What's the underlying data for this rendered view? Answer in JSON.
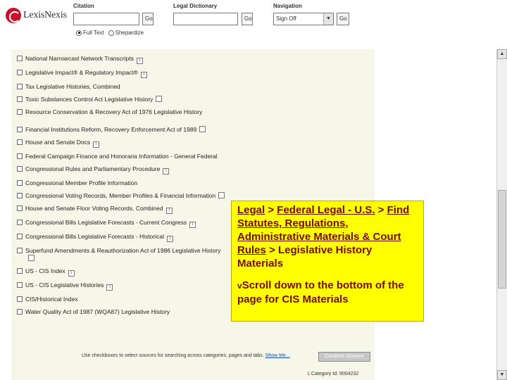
{
  "header": {
    "logo_text": "LexisNexis",
    "citation_label": "Citation",
    "citation_go": "Go",
    "dictionary_label": "Legal Dictionary",
    "dictionary_go": "Go",
    "navigation_label": "Navigation",
    "navigation_selected": "Sign Off",
    "navigation_go": "Go",
    "radio_full_text": "Full Text",
    "radio_shepardize": "Shepardize"
  },
  "list": {
    "items": [
      "National Narrowcast Network Transcripts",
      "Legislative Impact® & Regulatory Impact®",
      "Tax Legislative Histories, Combined",
      "Toxic Substances Control Act Legislative History",
      "Resource Conservation & Recovery Act of 1976 Legislative History",
      "Financial Institutions Reform, Recovery Enforcement Act of 1989",
      "House and Senate Docs",
      "Federal Campaign Finance and Honoraria Information - General Federal",
      "Congressional Rules and Parliamentary Procedure",
      "Congressional Member Profile Information",
      "Congressional Voting Records, Member Profiles & Financial Information",
      "House and Senate Floor Voting Records, Combined",
      "Congressional Bills Legislative Forecasts - Current Congress",
      "Congressional Bills Legislative Forecasts - Historical",
      "Superfund Amendments & Reauthorization Act of 1986 Legislative History",
      "US - CIS Index",
      "US - CIS Legislative Histories",
      "CIS/Historical Index",
      "Water Quality Act of 1987 (WQA87) Legislative History"
    ],
    "info_glyph": "i"
  },
  "footer": {
    "hint_text": "Use checkboxes to select sources for searching across categories, pages and tabs.",
    "show_me": "Show Me...",
    "combine_button": "Combine Sources",
    "category_marker": "1",
    "category_id": "Category Id: 9004232"
  },
  "callout": {
    "crumb_1": "Legal",
    "sep_1": " > ",
    "crumb_2": "Federal Legal - U.S.",
    "sep_2": " > ",
    "crumb_3": "Find Statutes, Regulations, Administrative Materials & Court Rules",
    "sep_3": " > ",
    "crumb_4": "Legislative History Materials",
    "bullet": "v",
    "note": "Scroll down to the bottom of the page for CIS Materials"
  },
  "colors": {
    "logo_red": "#c8102e",
    "callout_bg": "#ffff00",
    "callout_text": "#7a0a00",
    "panel_bg": "#f7f7e9"
  }
}
